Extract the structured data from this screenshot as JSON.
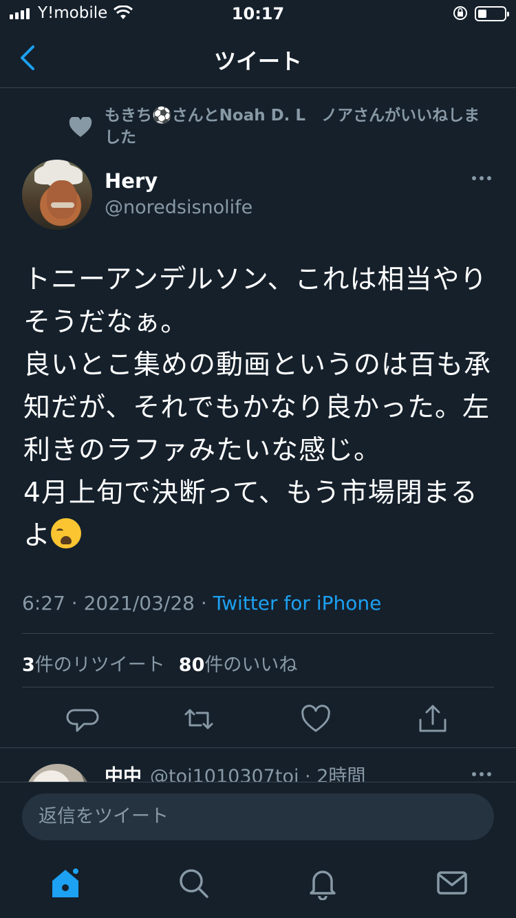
{
  "status_bar": {
    "carrier": "Y!mobile",
    "time": "10:17"
  },
  "nav": {
    "title": "ツイート"
  },
  "liked_by": {
    "text": "もきち⚽️さんとNoah D. L　ノアさんがいいねしました"
  },
  "tweet": {
    "author_name": "Hery",
    "author_handle": "@noredsisnolife",
    "text": "トニーアンデルソン、これは相当やりそうだなぁ。\n良いとこ集めの動画というのは百も承知だが、それでもかなり良かった。左利きのラファみたいな感じ。\n4月上旬で決断って、もう市場閉まるよ",
    "emoji": "loudly-crying-face",
    "timestamp": "6:27 · 2021/03/28 · ",
    "source": "Twitter for iPhone",
    "retweet_count": "3",
    "retweet_label": "件のリツイート",
    "like_count": "80",
    "like_label": "件のいいね"
  },
  "reply_preview": {
    "name": "中中",
    "handle_time": "@toi1010307toi · 2時間"
  },
  "composer": {
    "placeholder": "返信をツイート"
  },
  "colors": {
    "background": "#15202b",
    "accent": "#1da1f2",
    "muted": "#8899a6",
    "divider": "#38444d"
  },
  "icons": {
    "actions": [
      "reply-icon",
      "retweet-icon",
      "like-icon",
      "share-icon"
    ],
    "tabs": [
      "home-icon",
      "search-icon",
      "notifications-icon",
      "messages-icon"
    ]
  }
}
